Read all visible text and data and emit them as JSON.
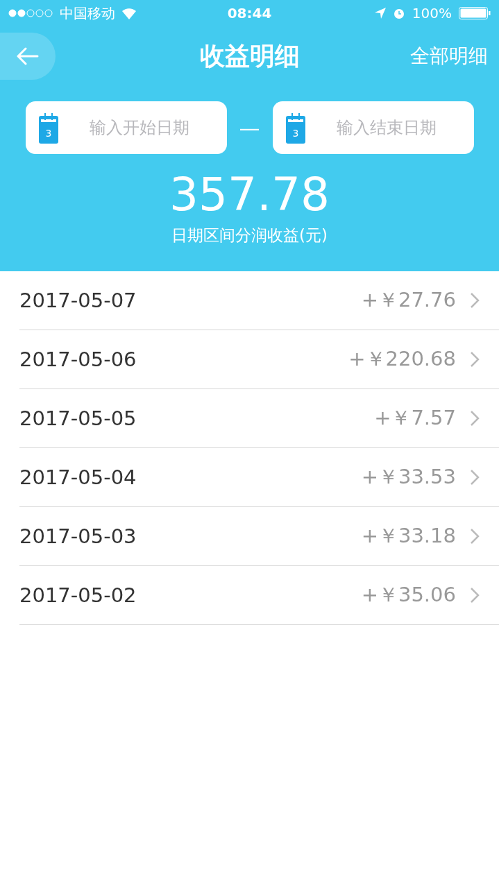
{
  "status_bar": {
    "carrier": "中国移动",
    "time": "08:44",
    "battery": "100%"
  },
  "nav": {
    "title": "收益明细",
    "action": "全部明细"
  },
  "date_range": {
    "start": {
      "placeholder": "输入开始日期",
      "icon_day": "3"
    },
    "separator": "—",
    "end": {
      "placeholder": "输入结束日期",
      "icon_day": "3"
    }
  },
  "summary": {
    "amount": "357.78",
    "label": "日期区间分润收益(元)"
  },
  "rows": [
    {
      "date": "2017-05-07",
      "amount": "+￥27.76"
    },
    {
      "date": "2017-05-06",
      "amount": "+￥220.68"
    },
    {
      "date": "2017-05-05",
      "amount": "+￥7.57"
    },
    {
      "date": "2017-05-04",
      "amount": "+￥33.53"
    },
    {
      "date": "2017-05-03",
      "amount": "+￥33.18"
    },
    {
      "date": "2017-05-02",
      "amount": "+￥35.06"
    }
  ]
}
